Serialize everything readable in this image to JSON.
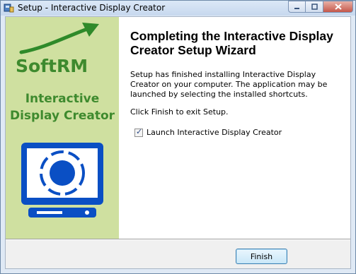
{
  "window": {
    "title": "Setup - Interactive Display Creator",
    "app_icon": "installer-icon",
    "controls": [
      "minimize-icon",
      "maximize-icon",
      "close-icon"
    ]
  },
  "sidebar": {
    "brand": "SoftRM",
    "product_line1": "Interactive",
    "product_line2": "Display Creator",
    "illustration": "monitor-target-icon",
    "background_color": "#cfe0a0",
    "accent_color": "#3e8a2e",
    "monitor_color": "#0a4fc4"
  },
  "main": {
    "heading": "Completing the Interactive Display Creator Setup Wizard",
    "message": "Setup has finished installing Interactive Display Creator on your computer. The application may be launched by selecting the installed shortcuts.",
    "instruction": "Click Finish to exit Setup.",
    "launch_checkbox": {
      "label": "Launch Interactive Display Creator",
      "checked": true
    }
  },
  "footer": {
    "finish_label": "Finish"
  }
}
